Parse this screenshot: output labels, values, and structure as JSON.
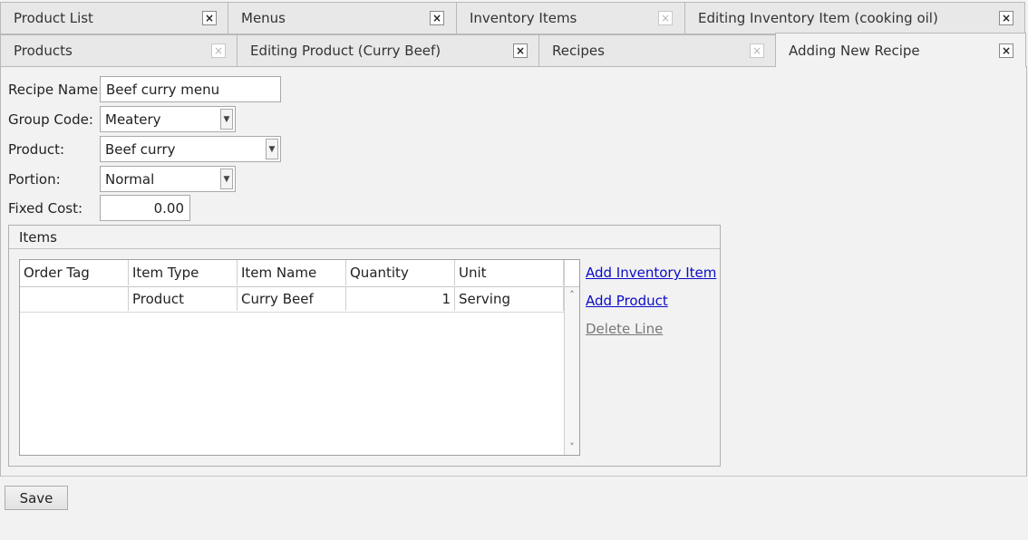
{
  "tabs_row1": [
    {
      "label": "Product List",
      "close": "×",
      "close_enabled": true
    },
    {
      "label": "Menus",
      "close": "×",
      "close_enabled": true
    },
    {
      "label": "Inventory Items",
      "close": "×",
      "close_enabled": false
    },
    {
      "label": "Editing Inventory Item (cooking oil)",
      "close": "×",
      "close_enabled": true
    }
  ],
  "tabs_row2": [
    {
      "label": "Products",
      "close": "×",
      "close_enabled": false
    },
    {
      "label": "Editing Product (Curry Beef)",
      "close": "×",
      "close_enabled": true
    },
    {
      "label": "Recipes",
      "close": "×",
      "close_enabled": false
    },
    {
      "label": "Adding New Recipe",
      "close": "×",
      "close_enabled": true,
      "active": true
    }
  ],
  "form": {
    "recipe_name_label": "Recipe Name:",
    "recipe_name_value": "Beef curry menu",
    "group_code_label": "Group Code:",
    "group_code_value": "Meatery",
    "product_label": "Product:",
    "product_value": "Beef curry",
    "portion_label": "Portion:",
    "portion_value": "Normal",
    "fixed_cost_label": "Fixed Cost:",
    "fixed_cost_value": "0.00",
    "dropdown_arrow": "▼"
  },
  "items": {
    "group_title": "Items",
    "columns": [
      "Order Tag",
      "Item Type",
      "Item Name",
      "Quantity",
      "Unit"
    ],
    "rows": [
      {
        "order_tag": "",
        "item_type": "Product",
        "item_name": "Curry Beef",
        "quantity": "1",
        "unit": "Serving"
      }
    ],
    "scroll_up": "˄",
    "scroll_down": "˅",
    "actions": {
      "add_inventory_item": "Add Inventory Item",
      "add_product": "Add Product",
      "delete_line": "Delete Line"
    }
  },
  "save_label": "Save",
  "colors": {
    "link": "#0b0bc8",
    "disabled_link": "#777777",
    "background": "#f2f2f2"
  }
}
